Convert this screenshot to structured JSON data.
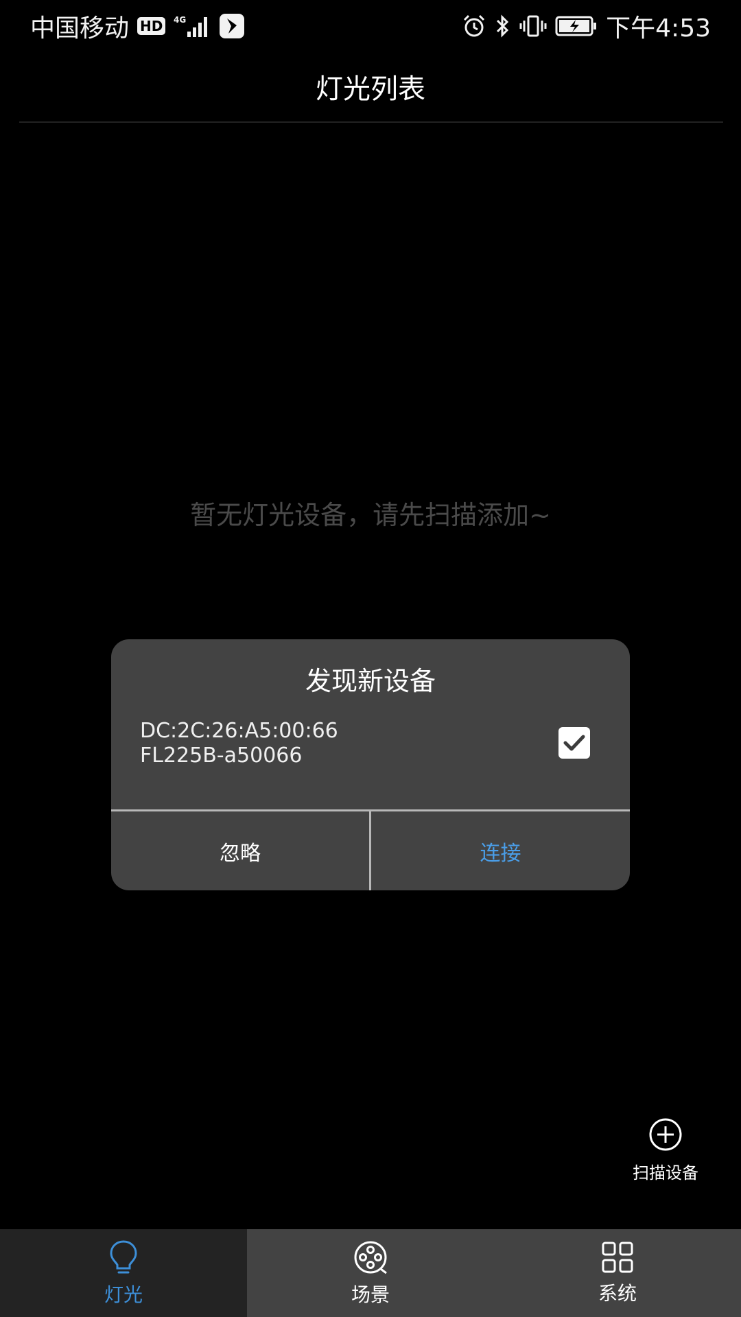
{
  "status_bar": {
    "carrier": "中国移动",
    "hd": "HD",
    "network": "4G",
    "time": "下午4:53"
  },
  "header": {
    "title": "灯光列表"
  },
  "empty_state": {
    "message": "暂无灯光设备，请先扫描添加~"
  },
  "dialog": {
    "title": "发现新设备",
    "device_mac": "DC:2C:26:A5:00:66",
    "device_name": "FL225B-a50066",
    "checked": true,
    "ignore_label": "忽略",
    "connect_label": "连接"
  },
  "scan": {
    "label": "扫描设备"
  },
  "bottom_nav": {
    "tabs": [
      {
        "label": "灯光",
        "icon": "bulb-icon",
        "active": true
      },
      {
        "label": "场景",
        "icon": "film-reel-icon",
        "active": false
      },
      {
        "label": "系统",
        "icon": "grid-icon",
        "active": false
      }
    ]
  },
  "colors": {
    "accent": "#3d8fd8",
    "dialog_bg": "#434343",
    "nav_bg": "#434343",
    "nav_active_bg": "#232323"
  }
}
